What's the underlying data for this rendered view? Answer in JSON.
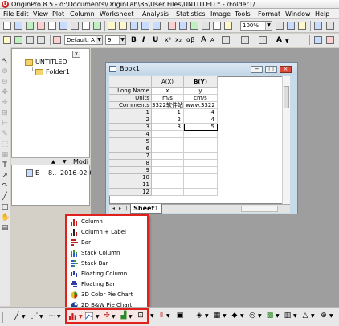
{
  "window": {
    "title": "OriginPro 8.5 - d:\\Documents\\OriginLab\\85\\User Files\\UNTITLED * - /Folder1/",
    "app_badge": "O"
  },
  "menu": [
    "File",
    "Edit",
    "View",
    "Plot",
    "Column",
    "Worksheet",
    "Analysis",
    "Statistics",
    "Image",
    "Tools",
    "Format",
    "Window",
    "Help"
  ],
  "toolbar": {
    "zoom": "100%",
    "font": "Default: A",
    "font_size": "9",
    "bold": "B",
    "italic": "I",
    "underline": "U",
    "greek": "αβ",
    "text_a_big": "A",
    "text_a_small": "A",
    "font_color": "A"
  },
  "project": {
    "root": "UNTITLED",
    "folder": "Folder1",
    "split_label": "Modi",
    "list_name": "E",
    "list_dots": "8..",
    "list_date": "2016-02-0",
    "close_mark": "x"
  },
  "book": {
    "title": "Book1",
    "columns": [
      "A(X)",
      "B(Y)"
    ],
    "meta_rows": [
      {
        "label": "Long Name",
        "values": [
          "x",
          "y"
        ]
      },
      {
        "label": "Units",
        "values": [
          "m/s",
          "cm/s"
        ]
      },
      {
        "label": "Comments",
        "values": [
          "3322软件站",
          "www.3322"
        ]
      }
    ],
    "row_numbers": [
      "1",
      "2",
      "3",
      "4",
      "5",
      "6",
      "7",
      "8",
      "9",
      "10",
      "11",
      "12"
    ],
    "data": [
      [
        "1",
        "4"
      ],
      [
        "2",
        "4"
      ],
      [
        "3",
        "5"
      ],
      [
        "",
        ""
      ],
      [
        "",
        ""
      ],
      [
        "",
        ""
      ],
      [
        "",
        ""
      ],
      [
        "",
        ""
      ],
      [
        "",
        ""
      ],
      [
        "",
        ""
      ],
      [
        "",
        ""
      ],
      [
        "",
        ""
      ]
    ],
    "sheet_tab": "Sheet1"
  },
  "plot_menu": {
    "items": [
      {
        "label": "Column",
        "icon": "column-icon"
      },
      {
        "label": "Column + Label",
        "icon": "column-label-icon"
      },
      {
        "label": "Bar",
        "icon": "bar-icon"
      },
      {
        "label": "Stack Column",
        "icon": "stack-column-icon"
      },
      {
        "label": "Stack Bar",
        "icon": "stack-bar-icon"
      },
      {
        "label": "Floating Column",
        "icon": "floating-column-icon"
      },
      {
        "label": "Floating Bar",
        "icon": "floating-bar-icon"
      },
      {
        "label": "3D Color Pie Chart",
        "icon": "3d-pie-icon"
      },
      {
        "label": "2D B&W Pie Chart",
        "icon": "2d-pie-icon"
      }
    ]
  },
  "colors": {
    "accent_red": "#e0211b",
    "book_frame": "#c8dbe9",
    "workspace": "#9e9e9e"
  }
}
